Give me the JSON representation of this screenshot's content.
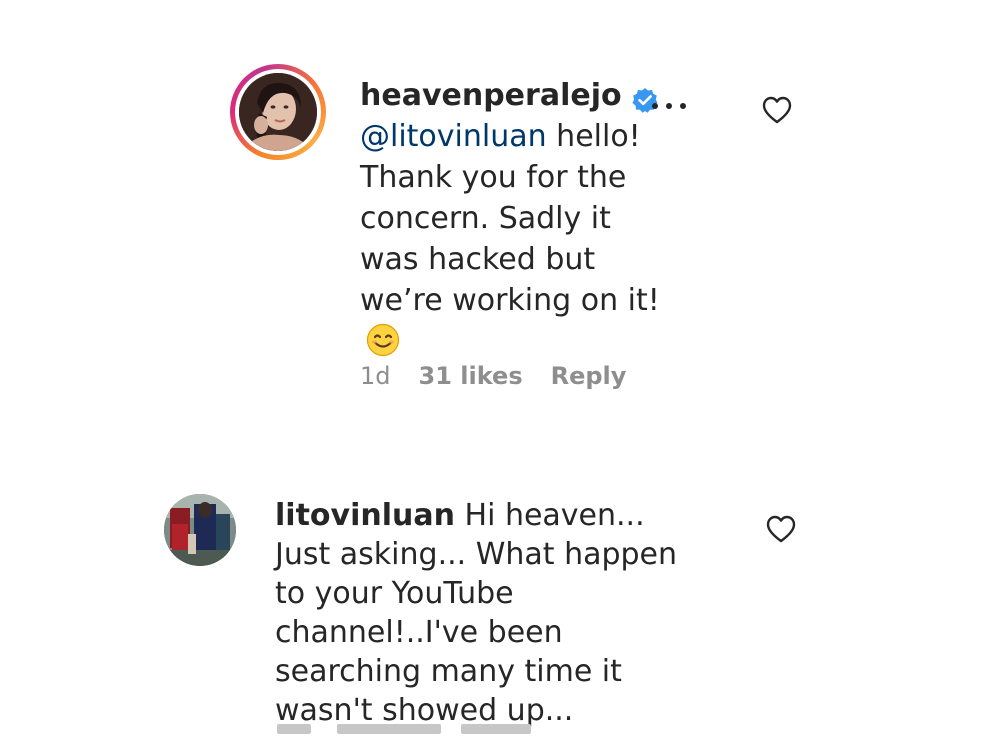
{
  "reply": {
    "username": "heavenperalejo",
    "verified": true,
    "mention": "@litovinluan",
    "text_after_mention": " hello!",
    "text_rest": "Thank you for the concern. Sadly it was hacked but we’re working on it!",
    "emoji": "smiling-face-emoji",
    "time": "1d",
    "likes": "31 likes",
    "reply_label": "Reply",
    "icons": {
      "verified": "verified-badge-icon",
      "more": "more-options-icon",
      "like": "heart-icon"
    },
    "colors": {
      "verified": "#3897f0",
      "mention": "#00376b",
      "meta": "#8e8e8e"
    }
  },
  "comment": {
    "username": "litovinluan",
    "text": "Hi heaven... Just asking... What happen to your YouTube channel!..I've been searching many time it wasn't showed up...",
    "icons": {
      "like": "heart-icon"
    }
  }
}
